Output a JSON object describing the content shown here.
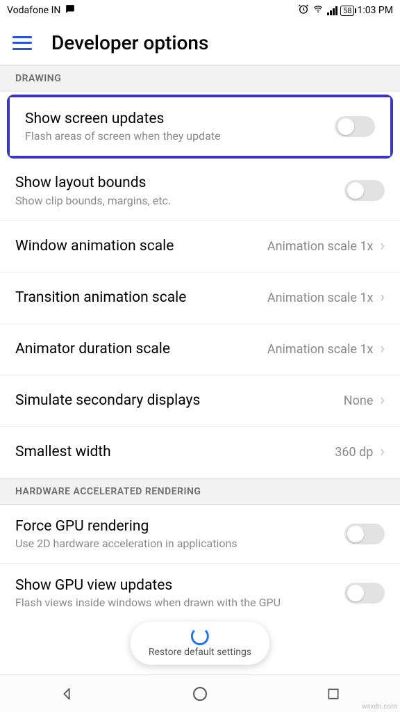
{
  "status": {
    "carrier": "Vodafone IN",
    "battery": "58",
    "time": "1:03 PM"
  },
  "header": {
    "title": "Developer options"
  },
  "sections": {
    "drawing": {
      "label": "DRAWING",
      "items": {
        "show_screen_updates": {
          "title": "Show screen updates",
          "sub": "Flash areas of screen when they update"
        },
        "show_layout_bounds": {
          "title": "Show layout bounds",
          "sub": "Show clip bounds, margins, etc."
        },
        "window_anim": {
          "title": "Window animation scale",
          "value": "Animation scale 1x"
        },
        "transition_anim": {
          "title": "Transition animation scale",
          "value": "Animation scale 1x"
        },
        "animator_duration": {
          "title": "Animator duration scale",
          "value": "Animation scale 1x"
        },
        "simulate_secondary": {
          "title": "Simulate secondary displays",
          "value": "None"
        },
        "smallest_width": {
          "title": "Smallest width",
          "value": "360 dp"
        }
      }
    },
    "hw_accel": {
      "label": "HARDWARE ACCELERATED RENDERING",
      "items": {
        "force_gpu": {
          "title": "Force GPU rendering",
          "sub": "Use 2D hardware acceleration in applications"
        },
        "show_gpu_view": {
          "title": "Show GPU view updates",
          "sub": "Flash views inside windows when drawn with the GPU"
        }
      }
    }
  },
  "pill": {
    "label": "Restore default settings"
  },
  "watermark": "wsxdn.com"
}
